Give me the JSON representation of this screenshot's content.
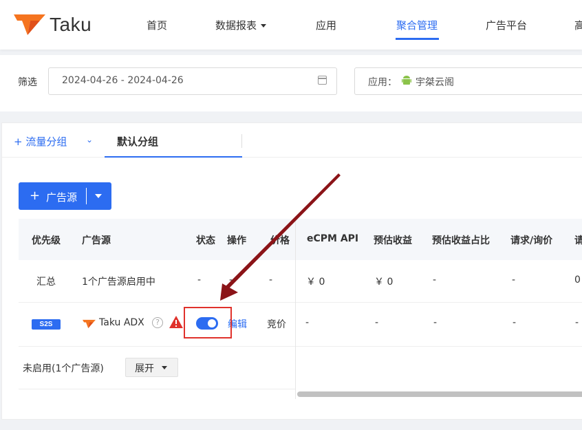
{
  "brand": {
    "name": "Taku",
    "accent": "#2c6cf1",
    "logo_orange": "#f5741f"
  },
  "nav": {
    "items": [
      {
        "label": "首页"
      },
      {
        "label": "数据报表"
      },
      {
        "label": "应用"
      },
      {
        "label": "聚合管理"
      },
      {
        "label": "广告平台"
      },
      {
        "label": "高"
      }
    ],
    "active_index": 3
  },
  "filter": {
    "label": "筛选",
    "date_range": "2024-04-26 - 2024-04-26",
    "app_label": "应用：",
    "app_name": "宇桀云阁"
  },
  "tabs": {
    "add_label": "+ 流量分组",
    "active_label": "默认分组"
  },
  "ad_source_button": {
    "label": "广告源",
    "plus": "+"
  },
  "table": {
    "headers": [
      "优先级",
      "广告源",
      "状态",
      "操作",
      "价格",
      "eCPM API",
      "预估收益",
      "预估收益占比",
      "请求/询价",
      "请"
    ],
    "summary_row": [
      "汇总",
      "1个广告源启用中",
      "-",
      "-",
      "-",
      "￥ 0",
      "￥ 0",
      "-",
      "-",
      "0"
    ],
    "source_row": {
      "badge": "S2S",
      "name": "Taku ADX",
      "help": "?",
      "toggle_on": true,
      "edit": "编辑",
      "price": "竞价",
      "cells": [
        "-",
        "-",
        "-",
        "-",
        "-"
      ]
    },
    "disabled_row": {
      "label": "未启用(1个广告源)",
      "expand": "展开"
    }
  },
  "annotation_color": "#e0312b"
}
